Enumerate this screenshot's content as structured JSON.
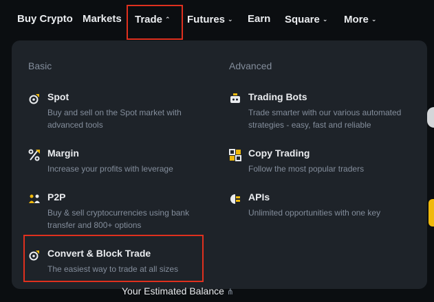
{
  "nav": {
    "items": [
      {
        "label": "Buy Crypto",
        "chevron": false
      },
      {
        "label": "Markets",
        "chevron": false
      },
      {
        "label": "Trade",
        "chevron": "up"
      },
      {
        "label": "Futures",
        "chevron": "down"
      },
      {
        "label": "Earn",
        "chevron": false
      },
      {
        "label": "Square",
        "chevron": "down"
      },
      {
        "label": "More",
        "chevron": "down"
      }
    ]
  },
  "dropdown": {
    "basic_title": "Basic",
    "advanced_title": "Advanced",
    "basic": [
      {
        "icon": "spot-icon",
        "title": "Spot",
        "desc": "Buy and sell on the Spot market with advanced tools"
      },
      {
        "icon": "margin-icon",
        "title": "Margin",
        "desc": "Increase your profits with leverage"
      },
      {
        "icon": "p2p-icon",
        "title": "P2P",
        "desc": "Buy & sell cryptocurrencies using bank transfer and 800+ options"
      },
      {
        "icon": "convert-icon",
        "title": "Convert & Block Trade",
        "desc": "The easiest way to trade at all sizes"
      }
    ],
    "advanced": [
      {
        "icon": "robot-icon",
        "title": "Trading Bots",
        "desc": "Trade smarter with our various automated strategies - easy, fast and reliable"
      },
      {
        "icon": "copy-trading-icon",
        "title": "Copy Trading",
        "desc": "Follow the most popular traders"
      },
      {
        "icon": "api-icon",
        "title": "APIs",
        "desc": "Unlimited opportunities with one key"
      }
    ]
  },
  "balance_label": "Your Estimated Balance",
  "colors": {
    "accent": "#f0b90b",
    "highlight": "#e0301e",
    "panel": "#1e2329",
    "background": "#0b0e11",
    "muted": "#848e9c"
  }
}
